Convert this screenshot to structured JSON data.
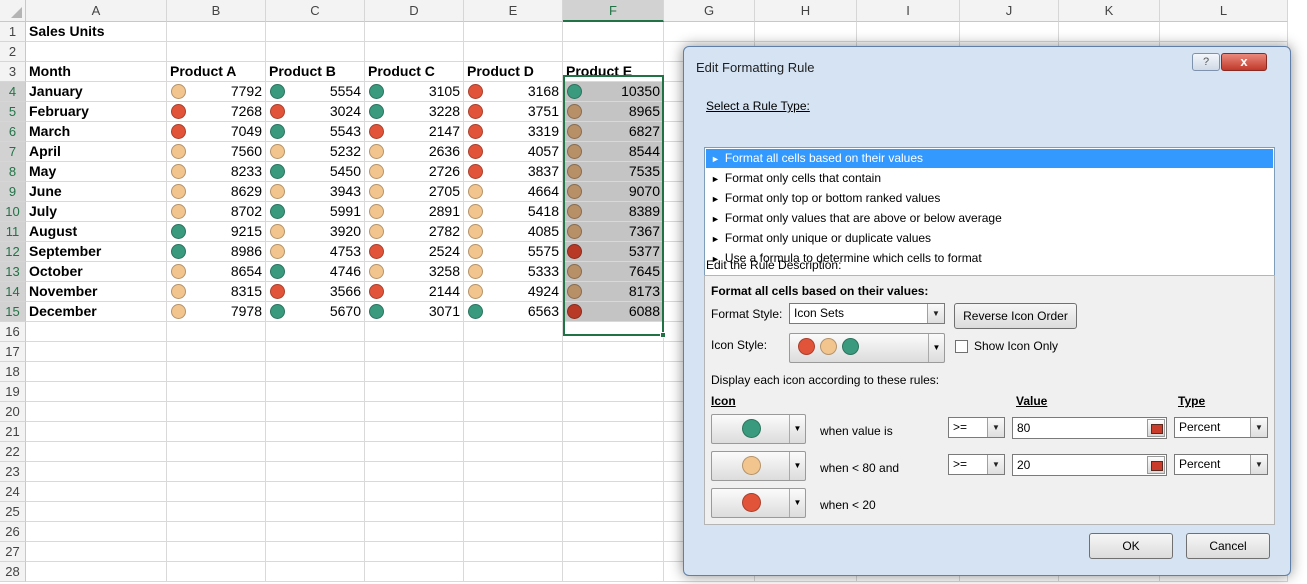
{
  "spreadsheet": {
    "columns": [
      "A",
      "B",
      "C",
      "D",
      "E",
      "F",
      "G",
      "H",
      "I",
      "J",
      "K",
      "L"
    ],
    "selected_column": "F",
    "row_numbers": [
      "1",
      "2",
      "3",
      "4",
      "5",
      "6",
      "7",
      "8",
      "9",
      "10",
      "11",
      "12",
      "13",
      "14",
      "15",
      "16",
      "17",
      "18",
      "19",
      "20",
      "21",
      "22",
      "23",
      "24",
      "25",
      "26",
      "27",
      "28"
    ],
    "title_cell": "Sales Units",
    "headers": [
      "Month",
      "Product A",
      "Product B",
      "Product C",
      "Product D",
      "Product E"
    ],
    "rows": [
      {
        "month": "January",
        "values": [
          "7792",
          "5554",
          "3105",
          "3168",
          "10350"
        ],
        "icons": [
          "yellow",
          "green",
          "green",
          "red",
          "green"
        ]
      },
      {
        "month": "February",
        "values": [
          "7268",
          "3024",
          "3228",
          "3751",
          "8965"
        ],
        "icons": [
          "red",
          "red",
          "green",
          "red",
          "yellow"
        ]
      },
      {
        "month": "March",
        "values": [
          "7049",
          "5543",
          "2147",
          "3319",
          "6827"
        ],
        "icons": [
          "red",
          "green",
          "red",
          "red",
          "yellow"
        ]
      },
      {
        "month": "April",
        "values": [
          "7560",
          "5232",
          "2636",
          "4057",
          "8544"
        ],
        "icons": [
          "yellow",
          "yellow",
          "yellow",
          "red",
          "yellow"
        ]
      },
      {
        "month": "May",
        "values": [
          "8233",
          "5450",
          "2726",
          "3837",
          "7535"
        ],
        "icons": [
          "yellow",
          "green",
          "yellow",
          "red",
          "yellow"
        ]
      },
      {
        "month": "June",
        "values": [
          "8629",
          "3943",
          "2705",
          "4664",
          "9070"
        ],
        "icons": [
          "yellow",
          "yellow",
          "yellow",
          "yellow",
          "yellow"
        ]
      },
      {
        "month": "July",
        "values": [
          "8702",
          "5991",
          "2891",
          "5418",
          "8389"
        ],
        "icons": [
          "yellow",
          "green",
          "yellow",
          "yellow",
          "yellow"
        ]
      },
      {
        "month": "August",
        "values": [
          "9215",
          "3920",
          "2782",
          "4085",
          "7367"
        ],
        "icons": [
          "green",
          "yellow",
          "yellow",
          "yellow",
          "yellow"
        ]
      },
      {
        "month": "September",
        "values": [
          "8986",
          "4753",
          "2524",
          "5575",
          "5377"
        ],
        "icons": [
          "green",
          "yellow",
          "red",
          "yellow",
          "red"
        ]
      },
      {
        "month": "October",
        "values": [
          "8654",
          "4746",
          "3258",
          "5333",
          "7645"
        ],
        "icons": [
          "yellow",
          "green",
          "yellow",
          "yellow",
          "yellow"
        ]
      },
      {
        "month": "November",
        "values": [
          "8315",
          "3566",
          "2144",
          "4924",
          "8173"
        ],
        "icons": [
          "yellow",
          "red",
          "red",
          "yellow",
          "yellow"
        ]
      },
      {
        "month": "December",
        "values": [
          "7978",
          "5670",
          "3071",
          "6563",
          "6088"
        ],
        "icons": [
          "yellow",
          "green",
          "green",
          "green",
          "red"
        ]
      }
    ]
  },
  "colors": {
    "icon_green": "#3a9a7e",
    "icon_yellow": "#f2c58e",
    "icon_red": "#e2543a",
    "dark_red": "#b83a26",
    "selection": "#217346",
    "list_highlight": "#3399ff"
  },
  "dialog": {
    "title": "Edit Formatting Rule",
    "help_glyph": "?",
    "close_glyph": "x",
    "select_rule_label": "Select a Rule Type:",
    "rule_types": [
      "Format all cells based on their values",
      "Format only cells that contain",
      "Format only top or bottom ranked values",
      "Format only values that are above or below average",
      "Format only unique or duplicate values",
      "Use a formula to determine which cells to format"
    ],
    "bullet": "►",
    "edit_desc_label": "Edit the Rule Description:",
    "desc_heading": "Format all cells based on their values:",
    "format_style_label": "Format Style:",
    "format_style_value": "Icon Sets",
    "reverse_button": "Reverse Icon Order",
    "icon_style_label": "Icon Style:",
    "icon_style_icons": [
      "red",
      "yellow",
      "green"
    ],
    "show_icon_only_label": "Show Icon Only",
    "display_rules_label": "Display each icon according to these rules:",
    "col_icon": "Icon",
    "col_value": "Value",
    "col_type": "Type",
    "icon_rules": [
      {
        "icon": "green",
        "condition": "when value is",
        "operator": ">=",
        "value": "80",
        "type": "Percent"
      },
      {
        "icon": "yellow",
        "condition": "when < 80 and",
        "operator": ">=",
        "value": "20",
        "type": "Percent"
      },
      {
        "icon": "red",
        "condition": "when < 20"
      }
    ],
    "ok_button": "OK",
    "cancel_button": "Cancel"
  }
}
